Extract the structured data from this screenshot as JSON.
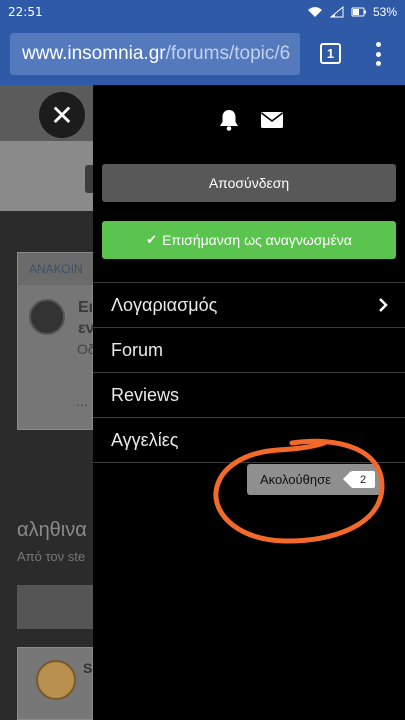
{
  "status_bar": {
    "time": "22:51",
    "battery": "53%",
    "icons": [
      "wifi-icon",
      "signal-icon",
      "battery-icon"
    ]
  },
  "browser": {
    "url_host": "www.insomnia.gr",
    "url_path": "/forums/topic/6",
    "tab_count": "1"
  },
  "background_page": {
    "card_header": "ΑΝΑΚΟΙΝ",
    "card_title_1": "Ει",
    "card_title_2": "εν",
    "card_sub": "Οδ",
    "card_dots": "...",
    "heading": "αληθινα",
    "subheading": "Από τον ste",
    "card2_initial": "S"
  },
  "drawer": {
    "icons": [
      "bell-icon",
      "mail-icon"
    ],
    "logout_label": "Αποσύνδεση",
    "mark_read_label": "Επισήμανση ως αναγνωσμένα",
    "nav": [
      {
        "label": "Λογαριασμός",
        "has_chevron": true
      },
      {
        "label": "Forum"
      },
      {
        "label": "Reviews"
      },
      {
        "label": "Αγγελίες"
      }
    ],
    "follow_label": "Ακολούθησε",
    "follow_count": "2"
  },
  "colors": {
    "browser_bar": "#2f5aa8",
    "mark_read_green": "#5bc44f",
    "logout_gray": "#585858",
    "annotation_orange": "#f2692a"
  }
}
